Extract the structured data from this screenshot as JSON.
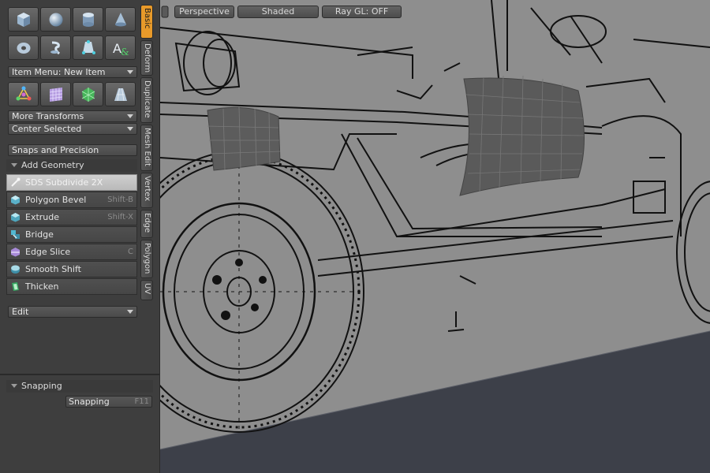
{
  "toolbar_top": {
    "row1": [
      {
        "icon": "cube-icon"
      },
      {
        "icon": "sphere-icon"
      },
      {
        "icon": "cylinder-icon"
      },
      {
        "icon": "cone-icon"
      }
    ],
    "row2": [
      {
        "icon": "torus-icon"
      },
      {
        "icon": "capsule-icon"
      },
      {
        "icon": "pen-tool-icon"
      },
      {
        "icon": "text-icon"
      }
    ],
    "row3": [
      {
        "icon": "transform-gizmo-icon"
      },
      {
        "icon": "grid-icon"
      },
      {
        "icon": "ball-icon"
      },
      {
        "icon": "plane-icon"
      }
    ]
  },
  "item_menu": {
    "label": "Item Menu: New Item"
  },
  "more_transforms": {
    "label": "More Transforms"
  },
  "center_selected": {
    "label": "Center Selected"
  },
  "snaps_precision": {
    "label": "Snaps and Precision"
  },
  "add_geometry": {
    "label": "Add Geometry"
  },
  "commands": [
    {
      "label": "SDS Subdivide 2X",
      "shortcut": "",
      "icon": "sds-subdivide-icon",
      "active": true
    },
    {
      "label": "Polygon Bevel",
      "shortcut": "Shift-B",
      "icon": "polygon-bevel-icon",
      "active": false
    },
    {
      "label": "Extrude",
      "shortcut": "Shift-X",
      "icon": "extrude-icon",
      "active": false
    },
    {
      "label": "Bridge",
      "shortcut": "",
      "icon": "bridge-icon",
      "active": false
    },
    {
      "label": "Edge Slice",
      "shortcut": "C",
      "icon": "edge-slice-icon",
      "active": false
    },
    {
      "label": "Smooth Shift",
      "shortcut": "",
      "icon": "smooth-shift-icon",
      "active": false
    },
    {
      "label": "Thicken",
      "shortcut": "",
      "icon": "thicken-icon",
      "active": false
    }
  ],
  "edit_dropdown": {
    "label": "Edit"
  },
  "vertical_tabs": [
    {
      "label": "Basic",
      "active": true
    },
    {
      "label": "Deform",
      "active": false
    },
    {
      "label": "Duplicate",
      "active": false
    },
    {
      "label": "Mesh Edit",
      "active": false
    },
    {
      "label": "Vertex",
      "active": false
    },
    {
      "label": "Edge",
      "active": false
    },
    {
      "label": "Polygon",
      "active": false
    },
    {
      "label": "UV",
      "active": false
    }
  ],
  "snapping_section": {
    "label": "Snapping",
    "field_label": "Snapping",
    "shortcut": "F11"
  },
  "viewport": {
    "view_mode": "Perspective",
    "shading": "Shaded",
    "raygl": "Ray GL: OFF"
  },
  "colors": {
    "accent_tab": "#e89a2a",
    "viewport_bg": "#8e8e8e",
    "floor": "#3d4049",
    "panel": "#3e3e3e"
  }
}
